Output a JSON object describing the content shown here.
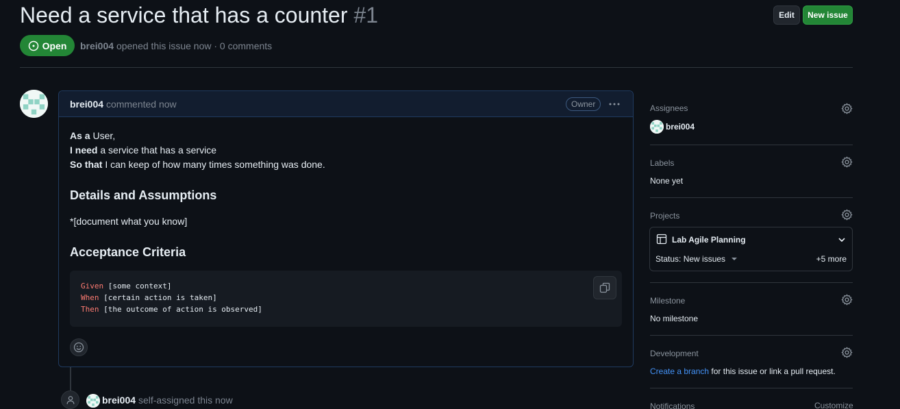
{
  "issue": {
    "title": "Need a service that has a counter",
    "number": "#1",
    "state": "Open",
    "author": "brei004",
    "meta_text": "opened this issue now · 0 comments"
  },
  "header_buttons": {
    "edit": "Edit",
    "new_issue": "New issue"
  },
  "comment": {
    "author": "brei004",
    "action": "commented now",
    "badge": "Owner",
    "story": [
      {
        "strong": "As a",
        "text": " User,"
      },
      {
        "strong": "I need",
        "text": " a service that has a service"
      },
      {
        "strong": "So that",
        "text": " I can keep of how many times something was done."
      }
    ],
    "heading_details": "Details and Assumptions",
    "details_text": "*[document what you know]",
    "heading_acceptance": "Acceptance Criteria",
    "code_lines": [
      {
        "keyword": "Given",
        "rest": " [some context]"
      },
      {
        "keyword": "When",
        "rest": " [certain action is taken]"
      },
      {
        "keyword": "Then",
        "rest": " [the outcome of action is observed]"
      }
    ]
  },
  "timeline": {
    "author": "brei004",
    "event": "self-assigned this now"
  },
  "sidebar": {
    "assignees": {
      "label": "Assignees",
      "value": "brei004"
    },
    "labels": {
      "label": "Labels",
      "value": "None yet"
    },
    "projects": {
      "label": "Projects",
      "name": "Lab Agile Planning",
      "status": "Status: New issues",
      "more": "+5 more"
    },
    "milestone": {
      "label": "Milestone",
      "value": "No milestone"
    },
    "development": {
      "label": "Development",
      "link_text": "Create a branch",
      "rest": " for this issue or link a pull request."
    },
    "notifications": {
      "label": "Notifications",
      "action": "Customize"
    }
  },
  "colors": {
    "background": "#0d1117",
    "open_green": "#238636",
    "link_blue": "#4493f8",
    "keyword_red": "#ff7b72"
  }
}
